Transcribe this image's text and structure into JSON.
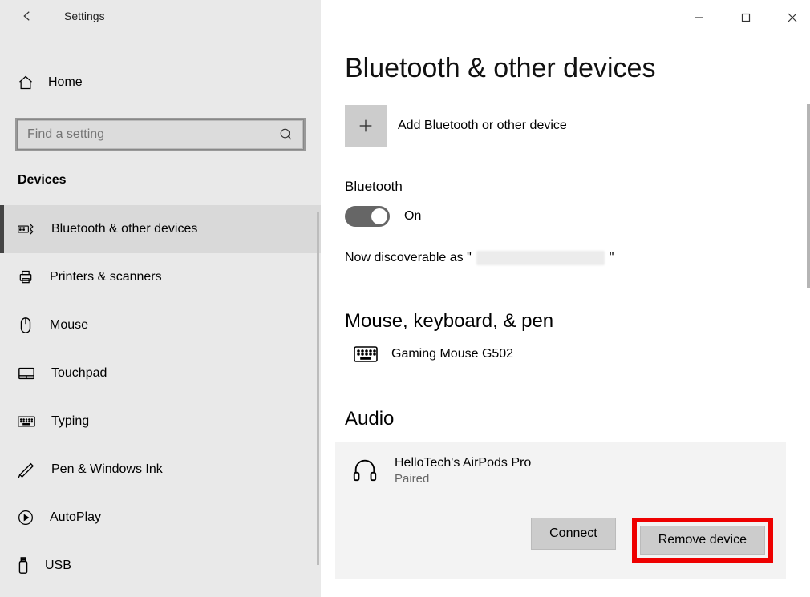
{
  "header": {
    "title": "Settings"
  },
  "sidebar": {
    "home_label": "Home",
    "search_placeholder": "Find a setting",
    "section_label": "Devices",
    "items": [
      {
        "label": "Bluetooth & other devices"
      },
      {
        "label": "Printers & scanners"
      },
      {
        "label": "Mouse"
      },
      {
        "label": "Touchpad"
      },
      {
        "label": "Typing"
      },
      {
        "label": "Pen & Windows Ink"
      },
      {
        "label": "AutoPlay"
      },
      {
        "label": "USB"
      }
    ]
  },
  "main": {
    "page_title": "Bluetooth & other devices",
    "add_device_label": "Add Bluetooth or other device",
    "bluetooth_label": "Bluetooth",
    "toggle_state": "On",
    "discoverable_prefix": "Now discoverable as \"",
    "discoverable_suffix": "\"",
    "section_mouse": "Mouse, keyboard, & pen",
    "devices_mkp": [
      {
        "name": "Gaming Mouse G502"
      }
    ],
    "section_audio": "Audio",
    "audio_device": {
      "name": "HelloTech's AirPods Pro",
      "status": "Paired",
      "connect_label": "Connect",
      "remove_label": "Remove device"
    }
  }
}
